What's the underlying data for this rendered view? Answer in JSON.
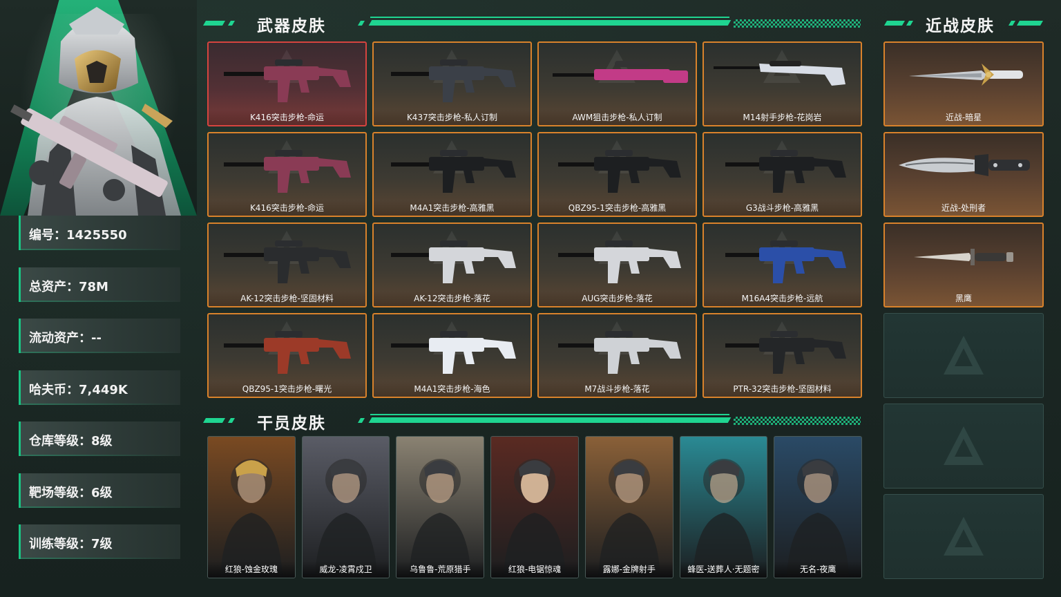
{
  "player": {
    "stats": [
      {
        "label": "编号：1425550"
      },
      {
        "label": "总资产：78M"
      },
      {
        "label": "流动资产：--"
      },
      {
        "label": "哈夫币：7,449K"
      },
      {
        "label": "仓库等级：8级"
      },
      {
        "label": "靶场等级：6级"
      },
      {
        "label": "训练等级：7级"
      }
    ]
  },
  "sections": {
    "weapons_title": "武器皮肤",
    "melee_title": "近战皮肤",
    "operators_title": "干员皮肤"
  },
  "weapons": [
    {
      "name": "K416突击步枪-命运",
      "rarity": "red",
      "color": "#8a3b55"
    },
    {
      "name": "K437突击步枪-私人订制",
      "rarity": "orange",
      "color": "#3b4048"
    },
    {
      "name": "AWM狙击步枪-私人订制",
      "rarity": "orange",
      "color": "#c23b87"
    },
    {
      "name": "M14射手步枪-花岗岩",
      "rarity": "orange",
      "color": "#d8dde6"
    },
    {
      "name": "K416突击步枪-命运",
      "rarity": "orange",
      "color": "#8a3b55"
    },
    {
      "name": "M4A1突击步枪-高雅黑",
      "rarity": "orange",
      "color": "#1d1f21"
    },
    {
      "name": "QBZ95-1突击步枪-高雅黑",
      "rarity": "orange",
      "color": "#1d1f21"
    },
    {
      "name": "G3战斗步枪-高雅黑",
      "rarity": "orange",
      "color": "#1d1f21"
    },
    {
      "name": "AK-12突击步枪-坚固材料",
      "rarity": "orange",
      "color": "#2a2c2e"
    },
    {
      "name": "AK-12突击步枪-落花",
      "rarity": "orange",
      "color": "#d4d6da"
    },
    {
      "name": "AUG突击步枪-落花",
      "rarity": "orange",
      "color": "#d4d6da"
    },
    {
      "name": "M16A4突击步枪-远航",
      "rarity": "orange",
      "color": "#2b4fa8"
    },
    {
      "name": "QBZ95-1突击步枪-曙光",
      "rarity": "orange",
      "color": "#9c3a28"
    },
    {
      "name": "M4A1突击步枪-海色",
      "rarity": "orange",
      "color": "#e8ecf2"
    },
    {
      "name": "M7战斗步枪-落花",
      "rarity": "orange",
      "color": "#cfd2d6"
    },
    {
      "name": "PTR-32突击步枪-坚固材料",
      "rarity": "orange",
      "color": "#242628"
    }
  ],
  "melee": [
    {
      "name": "近战-暗星"
    },
    {
      "name": "近战-处刑者"
    },
    {
      "name": "黑鹰"
    }
  ],
  "operators": [
    {
      "name": "红狼-蚀金玫瑰",
      "color": "#7a4a22"
    },
    {
      "name": "威龙-凌霄戍卫",
      "color": "#5a5c66"
    },
    {
      "name": "乌鲁鲁-荒原猎手",
      "color": "#8a8272"
    },
    {
      "name": "红狼-电锯惊魂",
      "color": "#5a2a22"
    },
    {
      "name": "露娜-金牌射手",
      "color": "#8a6038"
    },
    {
      "name": "蜂医-送葬人·无题密",
      "color": "#2a8a94"
    },
    {
      "name": "无名-夜鹰",
      "color": "#2a4a66"
    }
  ],
  "colors": {
    "accent": "#1fd591",
    "rare_orange": "#d9822b",
    "rare_red": "#d6443f"
  }
}
